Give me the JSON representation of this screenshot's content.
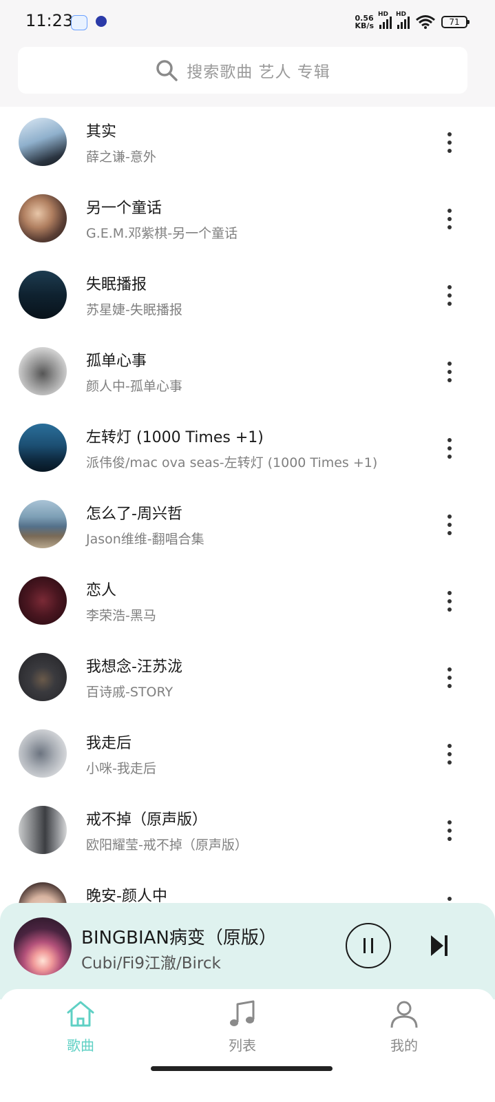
{
  "status_bar": {
    "time": "11:23",
    "net_speed_value": "0.56",
    "net_speed_unit": "KB/s",
    "hd_label": "HD",
    "battery": "71"
  },
  "search": {
    "placeholder": "搜索歌曲 艺人 专辑",
    "icon": "search-icon"
  },
  "songs": [
    {
      "title": "其实",
      "subtitle": "薛之谦-意外"
    },
    {
      "title": "另一个童话",
      "subtitle": "G.E.M.邓紫棋-另一个童话"
    },
    {
      "title": "失眠播报",
      "subtitle": "苏星婕-失眠播报"
    },
    {
      "title": "孤单心事",
      "subtitle": "颜人中-孤单心事"
    },
    {
      "title": "左转灯 (1000 Times +1)",
      "subtitle": "派伟俊/mac ova seas-左转灯 (1000 Times +1)"
    },
    {
      "title": "怎么了-周兴哲",
      "subtitle": "Jason维维-翻唱合集"
    },
    {
      "title": "恋人",
      "subtitle": "李荣浩-黑马"
    },
    {
      "title": "我想念-汪苏泷",
      "subtitle": "百诗戚-STORY"
    },
    {
      "title": "我走后",
      "subtitle": "小咪-我走后"
    },
    {
      "title": "戒不掉（原声版）",
      "subtitle": "欧阳耀莹-戒不掉（原声版）"
    },
    {
      "title": "晚安-颜人中",
      "subtitle": ""
    }
  ],
  "now_playing": {
    "title": "BINGBIAN病变（原版）",
    "artist": "Cubi/Fi9江澈/Birck"
  },
  "nav": {
    "songs": "歌曲",
    "lists": "列表",
    "mine": "我的"
  },
  "colors": {
    "accent": "#5fd0c4",
    "player_bg": "#dff2ef",
    "header_bg": "#f7f6f7"
  }
}
